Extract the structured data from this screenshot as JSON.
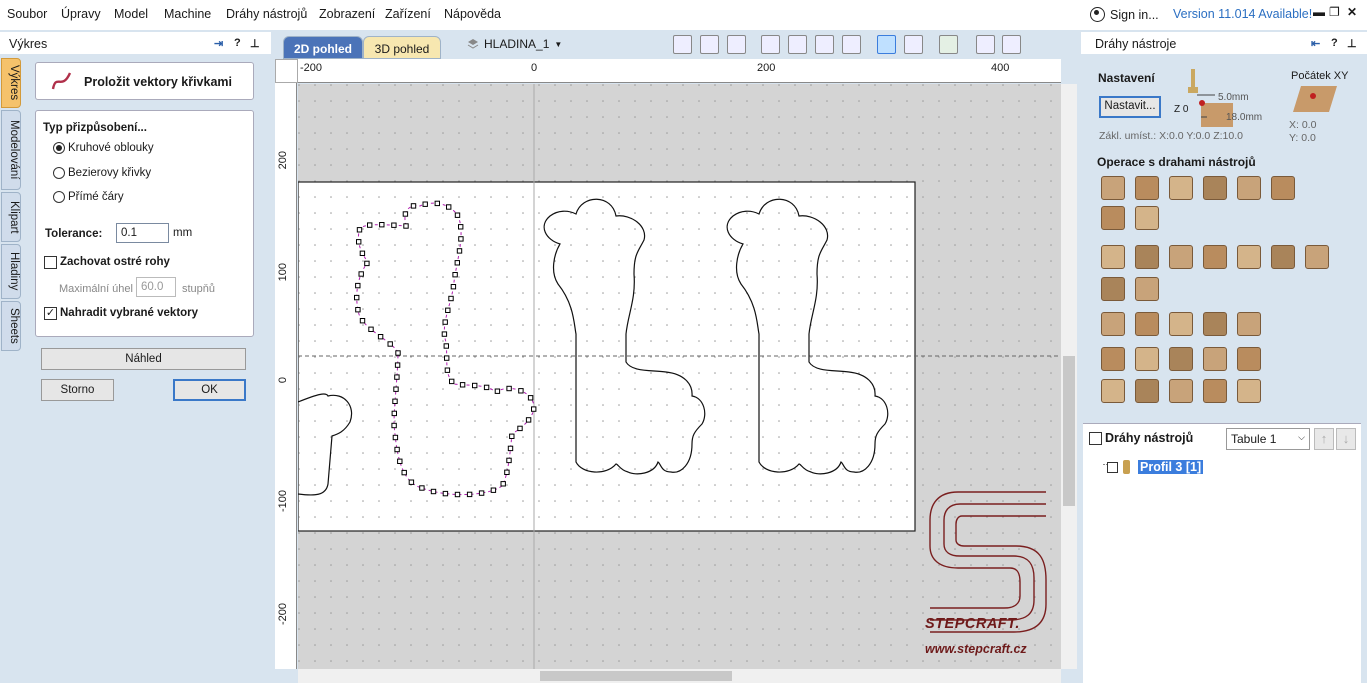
{
  "menu": [
    "Soubor",
    "Úpravy",
    "Model",
    "Machine",
    "Dráhy nástrojů",
    "Zobrazení",
    "Zařízení",
    "Nápověda"
  ],
  "signin": "Sign in...",
  "version": "Version 11.014 Available!",
  "left_panel": {
    "title": "Výkres",
    "tabs": [
      "Výkres",
      "Modelování",
      "Klipart",
      "Hladiny",
      "Sheets"
    ],
    "tool_title": "Proložit vektory křivkami",
    "fit_type_label": "Typ přizpůsobení...",
    "fit_options": [
      "Kruhové oblouky",
      "Bezierovy křivky",
      "Přímé čáry"
    ],
    "fit_selected": 0,
    "tolerance_label": "Tolerance:",
    "tolerance_value": "0.1",
    "tolerance_unit": "mm",
    "keep_corners_label": "Zachovat ostré rohy",
    "keep_corners_checked": false,
    "max_angle_label": "Maximální úhel",
    "max_angle_value": "60.0",
    "max_angle_unit": "stupňů",
    "replace_label": "Nahradit vybrané vektory",
    "replace_checked": true,
    "preview_button": "Náhled",
    "cancel_button": "Storno",
    "ok_button": "OK"
  },
  "view": {
    "tab_2d": "2D pohled",
    "tab_3d": "3D pohled",
    "layer": "HLADINA_1",
    "ruler_top": [
      "-200",
      "0",
      "200",
      "400"
    ],
    "ruler_left": [
      "200",
      "100",
      "0",
      "-100",
      "-200"
    ],
    "watermark_brand": "STEPCRAFT.",
    "watermark_url": "www.stepcraft.cz"
  },
  "right_panel": {
    "title": "Dráhy nástroje",
    "settings_label": "Nastavení",
    "setup_button": "Nastavit...",
    "z_label": "Z 0",
    "dim1": "5.0mm",
    "dim2": "18.0mm",
    "origin_label": "Počátek XY",
    "origin_x": "X: 0.0",
    "origin_y": "Y: 0.0",
    "home_pos": "Zákl. umíst.: X:0.0 Y:0.0 Z:10.0",
    "ops_label": "Operace s drahami nástrojů",
    "paths_label": "Dráhy nástrojů",
    "sheet_select": "Tabule 1",
    "path_item": "Profil 3 [1]"
  },
  "colors": {
    "panel": "#d8e4ef",
    "accent_tab": "#f5c26b",
    "selection": "#3b7ddd",
    "logo": "#7a1f1f"
  }
}
